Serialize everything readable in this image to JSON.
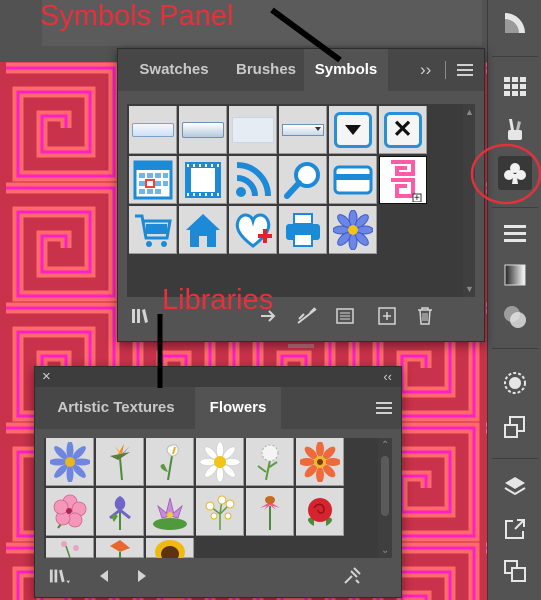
{
  "annotations": {
    "symbols_panel_label": "Symbols Panel",
    "libraries_label": "Libraries",
    "circle_color": "#e0323c"
  },
  "symbols_panel": {
    "tabs": [
      "Swatches",
      "Brushes",
      "Symbols"
    ],
    "active_tab": "Symbols",
    "expand_glyph": "››",
    "symbols": [
      "button-flat",
      "button-gradient",
      "button-blank",
      "dropdown-button",
      "dropdown-arrow-button",
      "close-x-button",
      "calendar",
      "film-strip",
      "rss-feed",
      "magnifier",
      "credit-card",
      "greek-key-pattern",
      "shopping-cart",
      "home",
      "heart-plus",
      "printer",
      "blue-flower"
    ],
    "footer_icons": [
      "libraries-menu-icon",
      "place-symbol-icon",
      "break-link-icon",
      "symbol-options-icon",
      "new-symbol-icon",
      "delete-symbol-icon"
    ]
  },
  "flowers_panel": {
    "tabs": [
      "Artistic Textures",
      "Flowers"
    ],
    "active_tab": "Flowers",
    "collapse_glyph": "‹‹",
    "close_glyph": "×",
    "items": [
      "aster-blue",
      "bird-of-paradise",
      "calla-lily",
      "daisy",
      "dandelion",
      "gerbera-orange",
      "hibiscus-pink",
      "iris",
      "water-lily",
      "flower-cluster",
      "coneflower",
      "rose-red",
      "small-flower",
      "lily-orange",
      "sunflower"
    ],
    "footer_icons": [
      "libraries-menu-icon",
      "previous-library-icon",
      "next-library-icon",
      "brush-library-icon"
    ]
  },
  "toolbar": {
    "items": [
      "color-guide",
      "swatches-grid",
      "brushes",
      "symbols",
      "stroke",
      "gradient",
      "transparency",
      "appearance",
      "transform",
      "layers",
      "export",
      "artboards"
    ],
    "selected": "symbols"
  }
}
